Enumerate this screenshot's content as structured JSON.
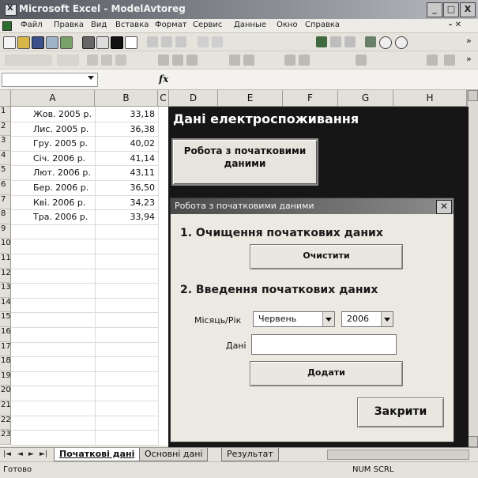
{
  "window": {
    "title": "Microsoft Excel - ModelAvtoreg",
    "controls": [
      "_",
      "□",
      "X"
    ]
  },
  "menu": [
    "Файл",
    "Правка",
    "Вид",
    "Вставка",
    "Формат",
    "Сервис",
    "Данные",
    "Окно",
    "Справка"
  ],
  "formula_bar": {
    "name_box": "",
    "fx": "fx",
    "value": ""
  },
  "columns": [
    "A",
    "B",
    "C",
    "D",
    "E",
    "F",
    "G",
    "H"
  ],
  "rows": [
    "1",
    "2",
    "3",
    "4",
    "5",
    "6",
    "7",
    "8",
    "9",
    "10",
    "11",
    "12",
    "13",
    "14",
    "15",
    "16",
    "17",
    "18",
    "19",
    "20",
    "21",
    "22",
    "23"
  ],
  "data_rows": [
    {
      "month": "Жов. 2005 р.",
      "value": "33,18"
    },
    {
      "month": "Лис. 2005 р.",
      "value": "36,38"
    },
    {
      "month": "Гру. 2005 р.",
      "value": "40,02"
    },
    {
      "month": "Січ. 2006 р.",
      "value": "41,14"
    },
    {
      "month": "Лют. 2006 р.",
      "value": "43,11"
    },
    {
      "month": "Бер. 2006 р.",
      "value": "36,50"
    },
    {
      "month": "Кві. 2006 р.",
      "value": "34,23"
    },
    {
      "month": "Тра. 2006 р.",
      "value": "33,94"
    }
  ],
  "dashboard": {
    "title": "Дані електроспоживання",
    "start_button": "Робота з початковими даними"
  },
  "dialog": {
    "title": "Робота з початковими даними",
    "section1": "1. Очищення початкових даних",
    "clear_button": "Очистити",
    "section2": "2. Введення початкових даних",
    "month_year_label": "Місяць/Рік",
    "month_value": "Червень",
    "year_value": "2006",
    "data_label": "Дані",
    "data_value": "",
    "add_button": "Додати",
    "close_button": "Закрити"
  },
  "sheet_tabs": [
    "Початкові дані",
    "Основні дані",
    "Результат"
  ],
  "status": {
    "ready": "Готово",
    "indicators": "NUM SCRL"
  }
}
